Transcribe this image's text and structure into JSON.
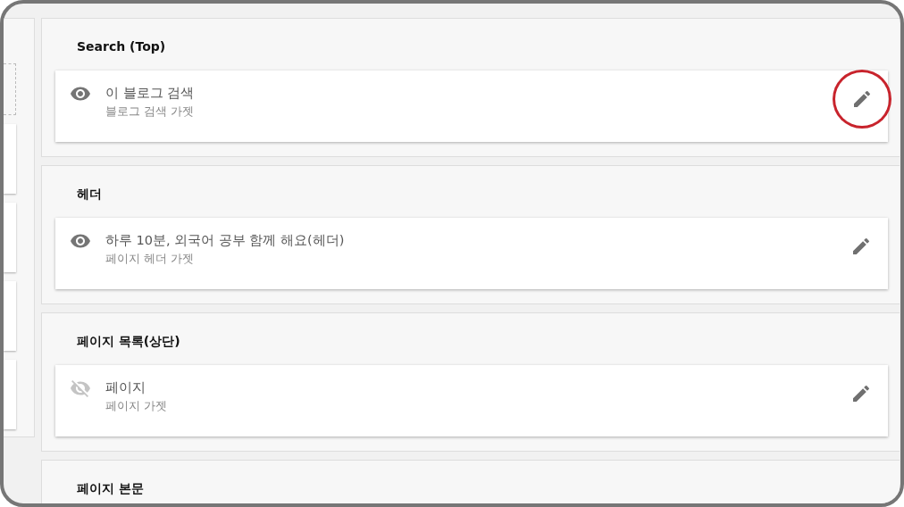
{
  "sections": [
    {
      "title": "Search (Top)",
      "gadgets": [
        {
          "title": "이 블로그 검색",
          "subtitle": "블로그 검색 가젯",
          "visible": true,
          "highlighted": true
        }
      ]
    },
    {
      "title": "헤더",
      "gadgets": [
        {
          "title": "하루 10분, 외국어 공부 함께 해요(헤더)",
          "subtitle": "페이지 헤더 가젯",
          "visible": true,
          "highlighted": false
        }
      ]
    },
    {
      "title": "페이지 목록(상단)",
      "gadgets": [
        {
          "title": "페이지",
          "subtitle": "페이지 가젯",
          "visible": false,
          "highlighted": false
        }
      ]
    },
    {
      "title": "페이지 본문"
    }
  ]
}
